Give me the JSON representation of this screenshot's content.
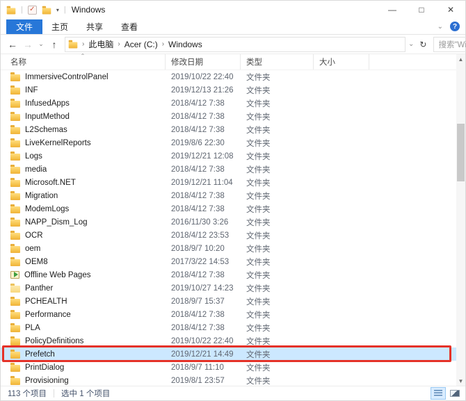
{
  "window": {
    "title": "Windows"
  },
  "titlebar": {
    "minimize": "—",
    "maximize": "□",
    "close": "✕",
    "qat_dropdown": "▾",
    "separator": "|"
  },
  "ribbon": {
    "tabs": [
      {
        "label": "文件",
        "active": true
      },
      {
        "label": "主页",
        "active": false
      },
      {
        "label": "共享",
        "active": false
      },
      {
        "label": "查看",
        "active": false
      }
    ],
    "collapse_chevron": "⌄",
    "help": "?"
  },
  "address": {
    "back": "←",
    "forward": "→",
    "recent_dropdown": "⌄",
    "up": "↑",
    "crumb_separator": "›",
    "path": [
      "此电脑",
      "Acer (C:)",
      "Windows"
    ],
    "dropdown": "⌄",
    "refresh": "↻",
    "search_placeholder": "搜索\"Win...",
    "search_icon": "🔎"
  },
  "columns": {
    "name": "名称",
    "date": "修改日期",
    "type": "类型",
    "size": "大小",
    "sort_indicator": "⌃"
  },
  "files": {
    "rows": [
      {
        "name": "ImmersiveControlPanel",
        "date": "2019/10/22 22:40",
        "type": "文件夹",
        "icon": "folder"
      },
      {
        "name": "INF",
        "date": "2019/12/13 21:26",
        "type": "文件夹",
        "icon": "folder"
      },
      {
        "name": "InfusedApps",
        "date": "2018/4/12 7:38",
        "type": "文件夹",
        "icon": "folder"
      },
      {
        "name": "InputMethod",
        "date": "2018/4/12 7:38",
        "type": "文件夹",
        "icon": "folder"
      },
      {
        "name": "L2Schemas",
        "date": "2018/4/12 7:38",
        "type": "文件夹",
        "icon": "folder"
      },
      {
        "name": "LiveKernelReports",
        "date": "2019/8/6 22:30",
        "type": "文件夹",
        "icon": "folder"
      },
      {
        "name": "Logs",
        "date": "2019/12/21 12:08",
        "type": "文件夹",
        "icon": "folder"
      },
      {
        "name": "media",
        "date": "2018/4/12 7:38",
        "type": "文件夹",
        "icon": "folder"
      },
      {
        "name": "Microsoft.NET",
        "date": "2019/12/21 11:04",
        "type": "文件夹",
        "icon": "folder"
      },
      {
        "name": "Migration",
        "date": "2018/4/12 7:38",
        "type": "文件夹",
        "icon": "folder"
      },
      {
        "name": "ModemLogs",
        "date": "2018/4/12 7:38",
        "type": "文件夹",
        "icon": "folder"
      },
      {
        "name": "NAPP_Dism_Log",
        "date": "2016/11/30 3:26",
        "type": "文件夹",
        "icon": "folder"
      },
      {
        "name": "OCR",
        "date": "2018/4/12 23:53",
        "type": "文件夹",
        "icon": "folder"
      },
      {
        "name": "oem",
        "date": "2018/9/7 10:20",
        "type": "文件夹",
        "icon": "folder"
      },
      {
        "name": "OEM8",
        "date": "2017/3/22 14:53",
        "type": "文件夹",
        "icon": "folder"
      },
      {
        "name": "Offline Web Pages",
        "date": "2018/4/12 7:38",
        "type": "文件夹",
        "icon": "offline-web"
      },
      {
        "name": "Panther",
        "date": "2019/10/27 14:23",
        "type": "文件夹",
        "icon": "folder-pale"
      },
      {
        "name": "PCHEALTH",
        "date": "2018/9/7 15:37",
        "type": "文件夹",
        "icon": "folder"
      },
      {
        "name": "Performance",
        "date": "2018/4/12 7:38",
        "type": "文件夹",
        "icon": "folder"
      },
      {
        "name": "PLA",
        "date": "2018/4/12 7:38",
        "type": "文件夹",
        "icon": "folder"
      },
      {
        "name": "PolicyDefinitions",
        "date": "2019/10/22 22:40",
        "type": "文件夹",
        "icon": "folder"
      },
      {
        "name": "Prefetch",
        "date": "2019/12/21 14:49",
        "type": "文件夹",
        "icon": "folder",
        "selected": true,
        "annotated": true
      },
      {
        "name": "PrintDialog",
        "date": "2018/9/7 11:10",
        "type": "文件夹",
        "icon": "folder"
      },
      {
        "name": "Provisioning",
        "date": "2019/8/1 23:57",
        "type": "文件夹",
        "icon": "folder"
      }
    ]
  },
  "statusbar": {
    "item_count": "113 个项目",
    "selection_count": "选中 1 个项目"
  },
  "colors": {
    "accent_blue": "#2777d8",
    "selection_blue": "#cce8ff",
    "annotation_red": "#e53228",
    "folder_yellow": "#f5c148"
  }
}
